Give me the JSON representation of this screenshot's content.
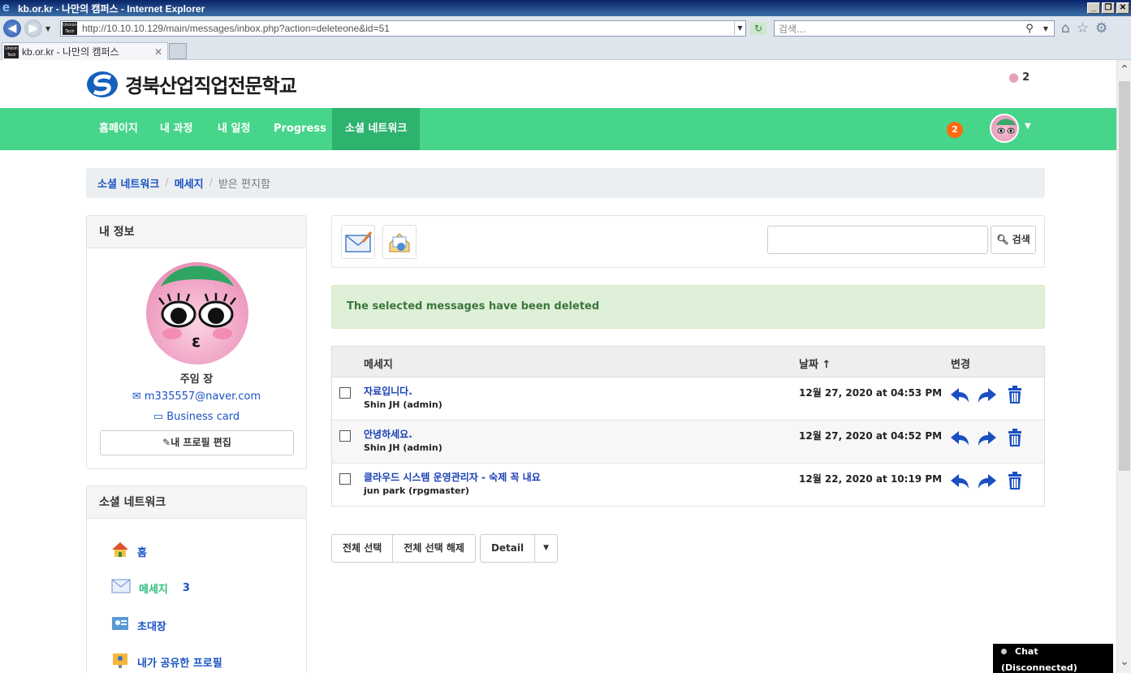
{
  "browser": {
    "title": "kb.or.kr - 나만의 캠퍼스 - Internet Explorer",
    "url": "http://10.10.10.129/main/messages/inbox.php?action=deleteone&id=51",
    "search_placeholder": "검색...",
    "tab_label": "kb.or.kr - 나만의 캠퍼스",
    "window_buttons": [
      "_",
      "❐",
      "✕"
    ]
  },
  "site": {
    "logo_text": "경북산업직업전문학교",
    "online_count": "2",
    "nav": [
      "홈페이지",
      "내 과정",
      "내 일정",
      "Progress",
      "소셜 네트워크"
    ],
    "notification_count": "2"
  },
  "breadcrumb": [
    "소셜 네트워크",
    "메세지",
    "받은 편지함"
  ],
  "profile": {
    "title": "내 정보",
    "name": "주임 장",
    "email": "m335557@naver.com",
    "business_card": "Business card",
    "edit_button": "내 프로필 편집"
  },
  "social": {
    "title": "소셜 네트워크",
    "items": [
      {
        "label": "홈",
        "icon": "home-icon"
      },
      {
        "label": "메세지",
        "count": "3",
        "icon": "envelope-icon"
      },
      {
        "label": "초대장",
        "icon": "invite-icon"
      },
      {
        "label": "내가 공유한 프로필",
        "icon": "shared-profile-icon"
      }
    ]
  },
  "toolbar": {
    "search_button": "검색"
  },
  "alert": "The selected messages have been deleted",
  "table": {
    "headers": [
      "메세지",
      "날짜 ↑",
      "변경"
    ],
    "rows": [
      {
        "subject": "자료입니다.",
        "from": "Shin JH (admin)",
        "date": "12월 27, 2020 at 04:53 PM"
      },
      {
        "subject": "안녕하세요.",
        "from": "Shin JH (admin)",
        "date": "12월 27, 2020 at 04:52 PM"
      },
      {
        "subject": "클라우드 시스템 운영관리자 - 숙제 꼭 내요",
        "from": "jun park (rpgmaster)",
        "date": "12월 22, 2020 at 10:19 PM"
      }
    ]
  },
  "buttons": {
    "select_all": "전체 선택",
    "deselect_all": "전체 선택 해제",
    "detail": "Detail"
  },
  "chat": "Chat (Disconnected)",
  "colors": {
    "nav_green": "#47d58b",
    "nav_active": "#2eb36f",
    "link_blue": "#1a52c4",
    "alert_bg": "#dff0d8"
  }
}
